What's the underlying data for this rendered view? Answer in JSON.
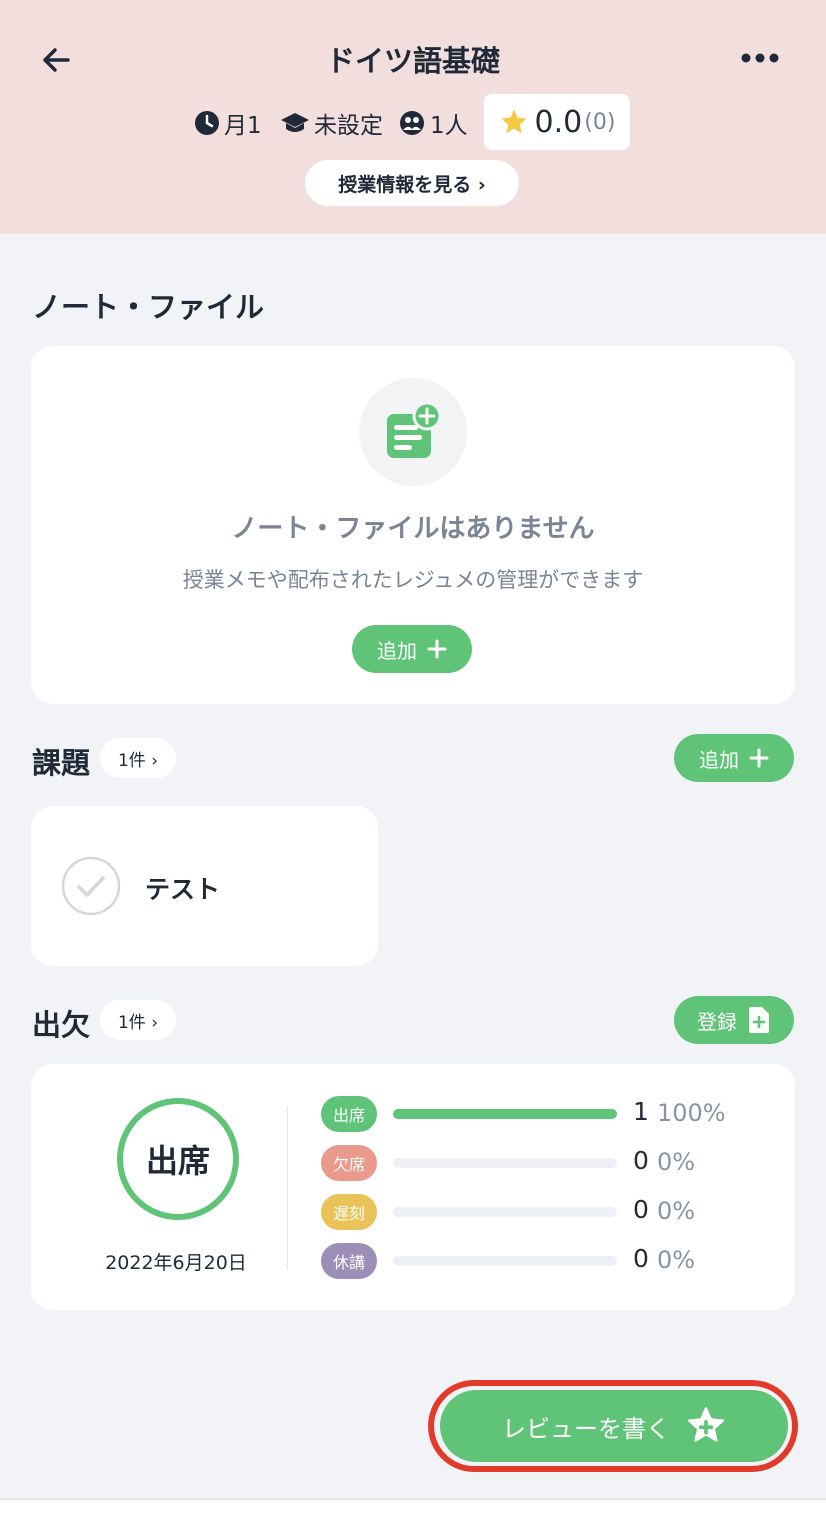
{
  "header": {
    "title": "ドイツ語基礎",
    "period": "月1",
    "room": "未設定",
    "members": "1人",
    "rating_value": "0.0",
    "rating_count": "(0)",
    "info_button": "授業情報を見る ›"
  },
  "notes": {
    "section_title": "ノート・ファイル",
    "empty_title": "ノート・ファイルはありません",
    "empty_subtitle": "授業メモや配布されたレジュメの管理ができます",
    "add_button": "追加"
  },
  "tasks": {
    "section_title": "課題",
    "count": "1件 ›",
    "add_button": "追加",
    "items": [
      {
        "label": "テスト"
      }
    ]
  },
  "attendance": {
    "section_title": "出欠",
    "count": "1件 ›",
    "register_button": "登録",
    "status": "出席",
    "date": "2022年6月20日",
    "rows": [
      {
        "label": "出席",
        "count": "1",
        "percent": "100%",
        "ratio": 1.0,
        "color": "#5fc477"
      },
      {
        "label": "欠席",
        "count": "0",
        "percent": "0%",
        "ratio": 0.0,
        "color": "#e99a8b"
      },
      {
        "label": "遅刻",
        "count": "0",
        "percent": "0%",
        "ratio": 0.0,
        "color": "#e9c258"
      },
      {
        "label": "休講",
        "count": "0",
        "percent": "0%",
        "ratio": 0.0,
        "color": "#9b8fb8"
      }
    ]
  },
  "review_button": "レビューを書く",
  "colors": {
    "accent": "#5fc477",
    "header_bg": "#f2dedd",
    "highlight": "#e33b2b",
    "star": "#f5c842"
  }
}
